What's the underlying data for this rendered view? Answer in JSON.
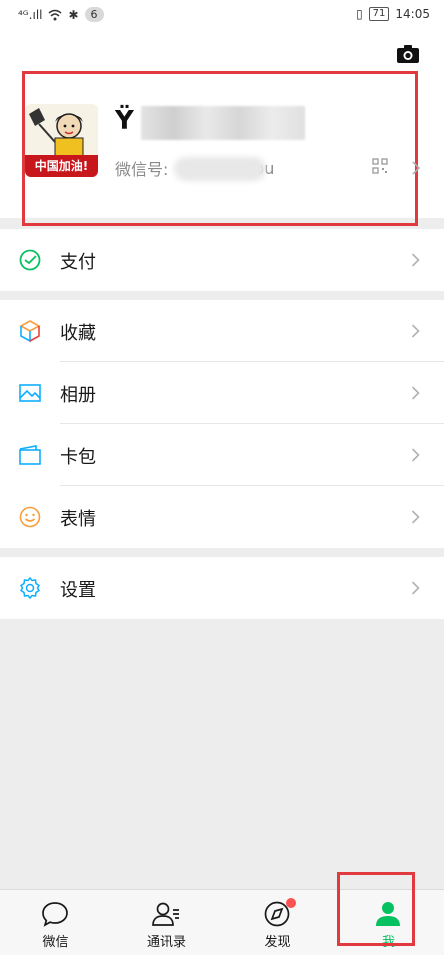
{
  "status_bar": {
    "signal": "⁴ᴳ.ıll",
    "notification_count": "6",
    "battery": "71",
    "time": "14:05"
  },
  "profile": {
    "avatar_banner": "中国加油!",
    "nickname_initial": "Ϋ",
    "wechat_id_label": "微信号:",
    "wechat_id_suffix": "ou"
  },
  "menu": {
    "pay": "支付",
    "favorites": "收藏",
    "album": "相册",
    "cards": "卡包",
    "stickers": "表情",
    "settings": "设置"
  },
  "tabs": {
    "chats": "微信",
    "contacts": "通讯录",
    "discover": "发现",
    "me": "我"
  },
  "colors": {
    "accent": "#07c160",
    "highlight": "#e0393e",
    "badge": "#fa5151"
  }
}
